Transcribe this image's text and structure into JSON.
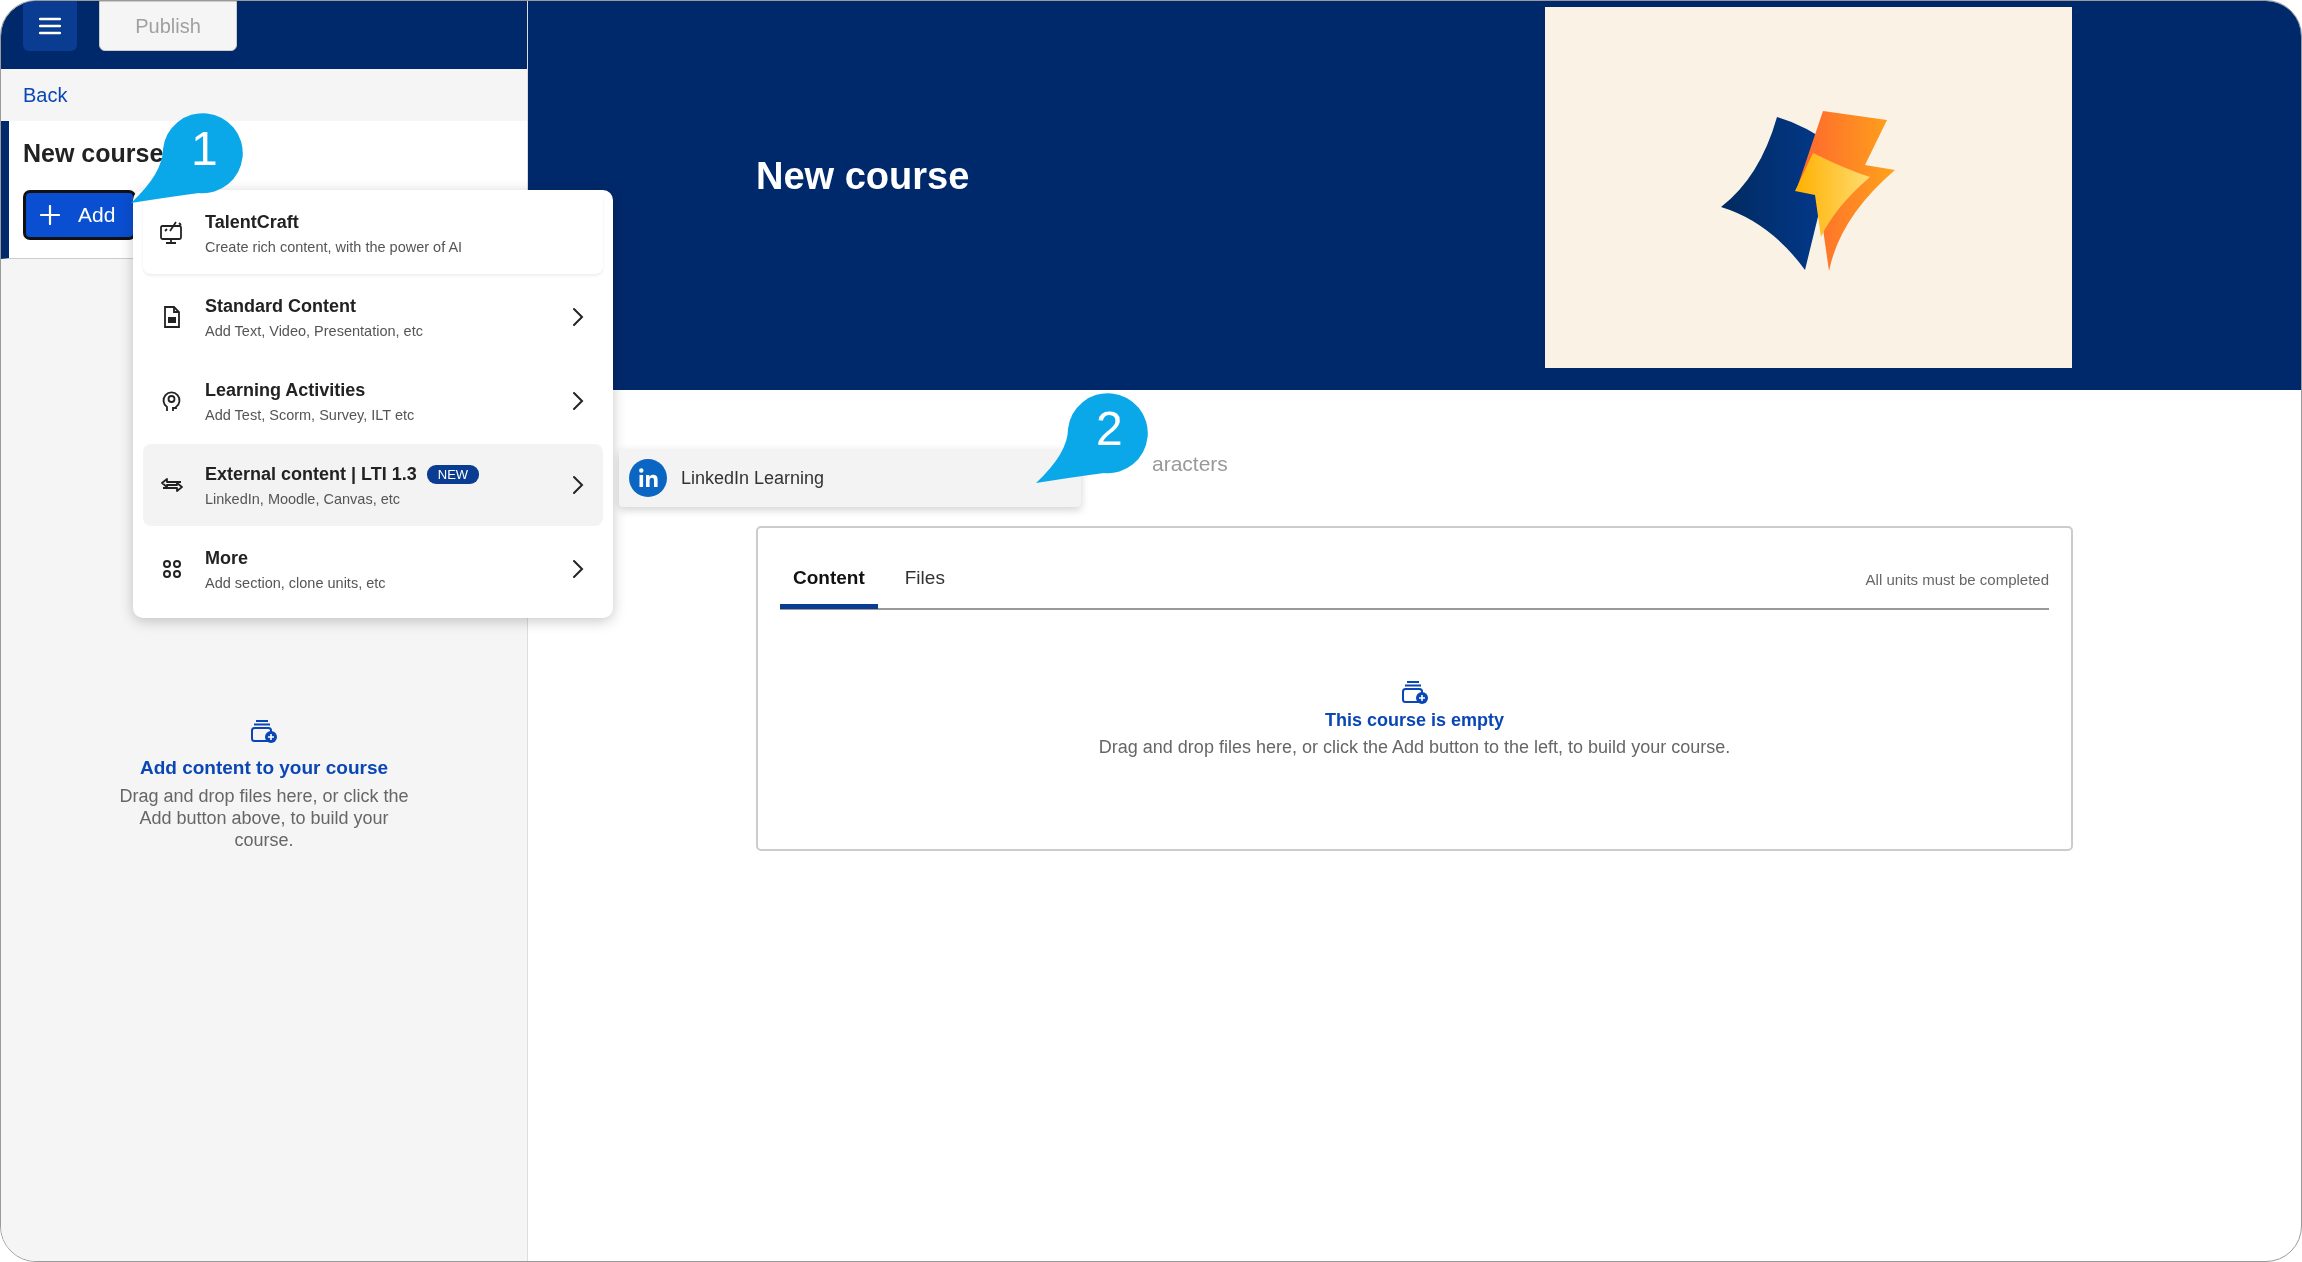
{
  "top_bar": {
    "publish_button": {
      "label": "Publish",
      "disabled": true
    }
  },
  "back_link": "Back",
  "course_title": "New course",
  "add_button": "Add",
  "add_menu": {
    "items": [
      {
        "title": "TalentCraft",
        "subtitle": "Create rich content, with the power of AI",
        "has_submenu": false,
        "selected": false
      },
      {
        "title": "Standard Content",
        "subtitle": "Add Text, Video, Presentation, etc",
        "has_submenu": true,
        "selected": false
      },
      {
        "title": "Learning Activities",
        "subtitle": "Add Test, Scorm, Survey, ILT etc",
        "has_submenu": true,
        "selected": false
      },
      {
        "title": "External content | LTI 1.3",
        "subtitle": "LinkedIn, Moodle, Canvas, etc",
        "badge": "NEW",
        "has_submenu": true,
        "selected": true
      },
      {
        "title": "More",
        "subtitle": "Add section, clone units, etc",
        "has_submenu": true,
        "selected": false
      }
    ]
  },
  "submenu": {
    "items": [
      {
        "title": "LinkedIn Learning"
      }
    ]
  },
  "sidebar_empty": {
    "title": "Add content to your course",
    "text": "Drag and drop files here, or click the Add button above, to build your course."
  },
  "banner": {
    "title": "New course"
  },
  "partial_text": "aracters",
  "content_panel": {
    "tabs": [
      {
        "label": "Content",
        "selected": true
      },
      {
        "label": "Files",
        "selected": false
      }
    ],
    "requirement": "All units must be completed",
    "empty": {
      "title": "This course is empty",
      "text": "Drag and drop files here, or click the Add button to the left, to build your course."
    }
  },
  "callouts": [
    {
      "label": "1"
    },
    {
      "label": "2"
    }
  ]
}
